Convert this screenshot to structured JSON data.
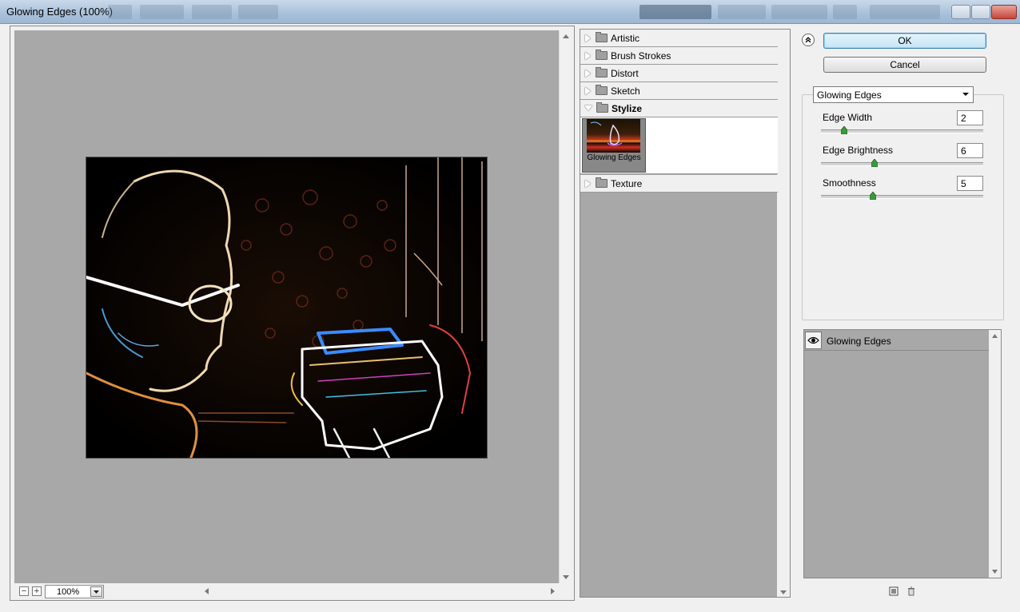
{
  "window": {
    "title": "Glowing Edges (100%)"
  },
  "preview": {
    "zoom": "100%",
    "zoom_out_glyph": "−",
    "zoom_in_glyph": "+"
  },
  "filter_tree": {
    "folders_top": [
      {
        "label": "Artistic",
        "expanded": false
      },
      {
        "label": "Brush Strokes",
        "expanded": false
      },
      {
        "label": "Distort",
        "expanded": false
      },
      {
        "label": "Sketch",
        "expanded": false
      }
    ],
    "expanded_folder": {
      "label": "Stylize",
      "expanded": true
    },
    "selected_filter": {
      "label": "Glowing Edges"
    },
    "folders_bottom": [
      {
        "label": "Texture",
        "expanded": false
      }
    ]
  },
  "buttons": {
    "ok": "OK",
    "cancel": "Cancel"
  },
  "settings": {
    "filter_select": "Glowing Edges",
    "params": [
      {
        "label": "Edge Width",
        "value": "2",
        "min": 1,
        "max": 14,
        "level": 2
      },
      {
        "label": "Edge Brightness",
        "value": "6",
        "min": 0,
        "max": 20,
        "level": 6
      },
      {
        "label": "Smoothness",
        "value": "5",
        "min": 1,
        "max": 15,
        "level": 5
      }
    ]
  },
  "layers": {
    "items": [
      {
        "label": "Glowing Edges",
        "visible": true
      }
    ]
  },
  "colors": {
    "preview_bg": "#a8a8a8",
    "ok_button": "#c4e5f6",
    "slider_thumb": "#3a9a3a"
  }
}
